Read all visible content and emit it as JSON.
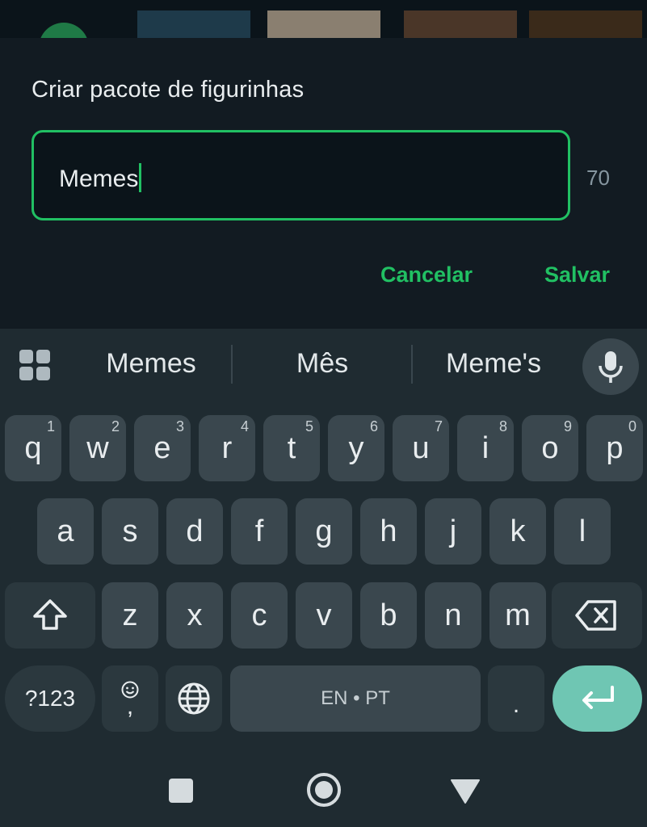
{
  "dialog": {
    "title": "Criar pacote de figurinhas",
    "input_value": "Memes",
    "char_counter": "70",
    "cancel_label": "Cancelar",
    "save_label": "Salvar"
  },
  "keyboard": {
    "suggestions": [
      "Memes",
      "Mês",
      "Meme's"
    ],
    "row1": [
      {
        "key": "q",
        "hint": "1"
      },
      {
        "key": "w",
        "hint": "2"
      },
      {
        "key": "e",
        "hint": "3"
      },
      {
        "key": "r",
        "hint": "4"
      },
      {
        "key": "t",
        "hint": "5"
      },
      {
        "key": "y",
        "hint": "6"
      },
      {
        "key": "u",
        "hint": "7"
      },
      {
        "key": "i",
        "hint": "8"
      },
      {
        "key": "o",
        "hint": "9"
      },
      {
        "key": "p",
        "hint": "0"
      }
    ],
    "row2": [
      "a",
      "s",
      "d",
      "f",
      "g",
      "h",
      "j",
      "k",
      "l"
    ],
    "row3": [
      "z",
      "x",
      "c",
      "v",
      "b",
      "n",
      "m"
    ],
    "symbols_label": "?123",
    "comma_label": ",",
    "space_label": "EN • PT",
    "period_label": ".",
    "icons": {
      "apps": "apps-grid-icon",
      "mic": "microphone-icon",
      "shift": "shift-icon",
      "backspace": "backspace-icon",
      "emoji": "emoji-icon",
      "globe": "globe-icon",
      "enter": "enter-icon"
    }
  },
  "navigation": {
    "icons": [
      "recents-square-icon",
      "home-circle-icon",
      "back-triangle-icon"
    ]
  },
  "colors": {
    "accent": "#21c063",
    "dialog_bg": "#121b22",
    "keyboard_bg": "#1f2b31",
    "key_bg": "#3a474e",
    "enter_bg": "#6fc6b3"
  }
}
